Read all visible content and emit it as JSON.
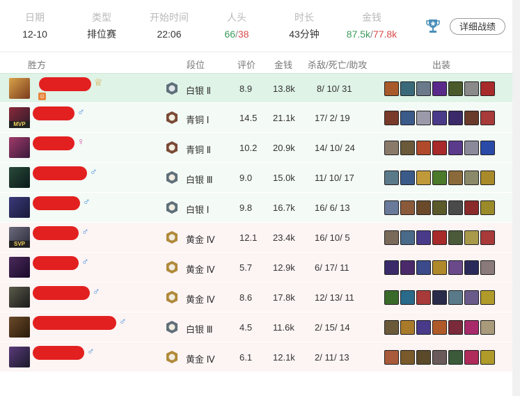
{
  "summary": {
    "date_label": "日期",
    "date_value": "12-10",
    "type_label": "类型",
    "type_value": "排位赛",
    "start_label": "开始时间",
    "start_value": "22:06",
    "kills_label": "人头",
    "kills_win": "66",
    "kills_sep": "/",
    "kills_loss": "38",
    "duration_label": "时长",
    "duration_value": "43分钟",
    "gold_label": "金钱",
    "gold_win": "87.5k",
    "gold_sep": "/",
    "gold_loss": "77.8k",
    "detail_button": "详细战绩"
  },
  "table_header": {
    "team": "胜方",
    "rank": "段位",
    "score": "评价",
    "gold": "金钱",
    "kda": "杀敌/死亡/助攻",
    "items": "出装"
  },
  "players": [
    {
      "rank": "白银 Ⅱ",
      "score": "8.9",
      "gold": "13.8k",
      "kda": "8/ 10/ 31",
      "gender": "",
      "badge": "",
      "tier": "silver",
      "team": "highlight",
      "score_color": "",
      "gold_color": "",
      "kda_color": "green-assist"
    },
    {
      "rank": "青铜 Ⅰ",
      "score": "14.5",
      "gold": "21.1k",
      "kda": "17/ 2/ 19",
      "gender": "♂",
      "badge": "MVP",
      "tier": "bronze",
      "team": "win",
      "score_color": "green",
      "gold_color": "",
      "kda_color": "green-kd"
    },
    {
      "rank": "青铜 Ⅱ",
      "score": "10.2",
      "gold": "20.9k",
      "kda": "14/ 10/ 24",
      "gender": "♀",
      "badge": "",
      "tier": "bronze",
      "team": "win",
      "score_color": "",
      "gold_color": "",
      "kda_color": ""
    },
    {
      "rank": "白银 Ⅲ",
      "score": "9.0",
      "gold": "15.0k",
      "kda": "11/ 10/ 17",
      "gender": "♂",
      "badge": "",
      "tier": "silver",
      "team": "win",
      "score_color": "",
      "gold_color": "",
      "kda_color": ""
    },
    {
      "rank": "白银 Ⅰ",
      "score": "9.8",
      "gold": "16.7k",
      "kda": "16/ 6/ 13",
      "gender": "♂",
      "badge": "",
      "tier": "silver",
      "team": "win",
      "score_color": "",
      "gold_color": "",
      "kda_color": ""
    },
    {
      "rank": "黄金 Ⅳ",
      "score": "12.1",
      "gold": "23.4k",
      "kda": "16/ 10/ 5",
      "gender": "♂",
      "badge": "SVP",
      "tier": "gold",
      "team": "loss",
      "score_color": "red",
      "gold_color": "red",
      "kda_color": ""
    },
    {
      "rank": "黄金 Ⅳ",
      "score": "5.7",
      "gold": "12.9k",
      "kda": "6/ 17/ 11",
      "gender": "♂",
      "badge": "",
      "tier": "gold",
      "team": "loss",
      "score_color": "",
      "gold_color": "",
      "kda_color": ""
    },
    {
      "rank": "黄金 Ⅳ",
      "score": "8.6",
      "gold": "17.8k",
      "kda": "12/ 13/ 11",
      "gender": "♂",
      "badge": "",
      "tier": "gold",
      "team": "loss",
      "score_color": "",
      "gold_color": "",
      "kda_color": ""
    },
    {
      "rank": "白银 Ⅲ",
      "score": "4.5",
      "gold": "11.6k",
      "kda": "2/ 15/ 14",
      "gender": "♂",
      "badge": "",
      "tier": "silver",
      "team": "loss",
      "score_color": "",
      "gold_color": "",
      "kda_color": ""
    },
    {
      "rank": "黄金 Ⅳ",
      "score": "6.1",
      "gold": "12.1k",
      "kda": "2/ 11/ 13",
      "gender": "♂",
      "badge": "",
      "tier": "gold",
      "team": "loss",
      "score_color": "",
      "gold_color": "",
      "kda_color": ""
    }
  ],
  "colors": {
    "win_green": "#3b9a5a",
    "loss_red": "#d84a4a",
    "highlight_row": "#dff3e7",
    "win_row": "#f4faf6",
    "loss_row": "#fdf4f4",
    "silver": "#5f6f7a",
    "bronze": "#7a4a36",
    "gold": "#b08a3a"
  }
}
